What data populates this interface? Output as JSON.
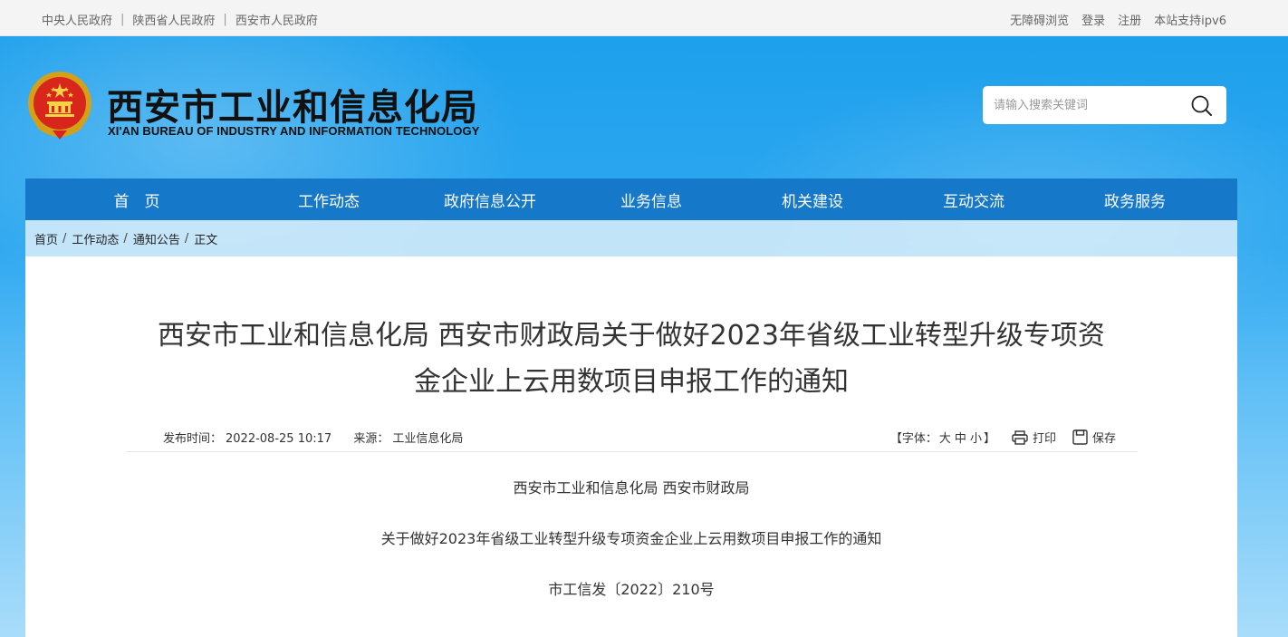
{
  "topbar": {
    "links": [
      "中央人民政府",
      "陕西省人民政府",
      "西安市人民政府"
    ],
    "separator": "|",
    "right": [
      "无障碍浏览",
      "登录",
      "注册",
      "本站支持ipv6"
    ]
  },
  "header": {
    "title": "西安市工业和信息化局",
    "subtitle": "XI'AN BUREAU OF INDUSTRY AND INFORMATION TECHNOLOGY",
    "search_placeholder": "请输入搜索关键词"
  },
  "nav": [
    "首　页",
    "工作动态",
    "政府信息公开",
    "业务信息",
    "机关建设",
    "互动交流",
    "政务服务"
  ],
  "breadcrumb": [
    "首页",
    "工作动态",
    "通知公告",
    "正文"
  ],
  "article": {
    "title_line1": "西安市工业和信息化局 西安市财政局关于做好2023年省级工业转型升级专项资",
    "title_line2": "金企业上云用数项目申报工作的通知",
    "publish_label": "发布时间：",
    "publish_time": "2022-08-25 10:17",
    "source_label": "来源：",
    "source": "工业信息化局",
    "font_label": "【字体：",
    "font_large": "大",
    "font_medium": "中",
    "font_small": "小",
    "font_close": "】",
    "print_label": "打印",
    "save_label": "保存",
    "para1": "西安市工业和信息化局 西安市财政局",
    "para2": "关于做好2023年省级工业转型升级专项资金企业上云用数项目申报工作的通知",
    "para3": "市工信发〔2022〕210号"
  },
  "colors": {
    "nav_bg": "#1678c8",
    "banner_top": "#1ea0ec"
  }
}
